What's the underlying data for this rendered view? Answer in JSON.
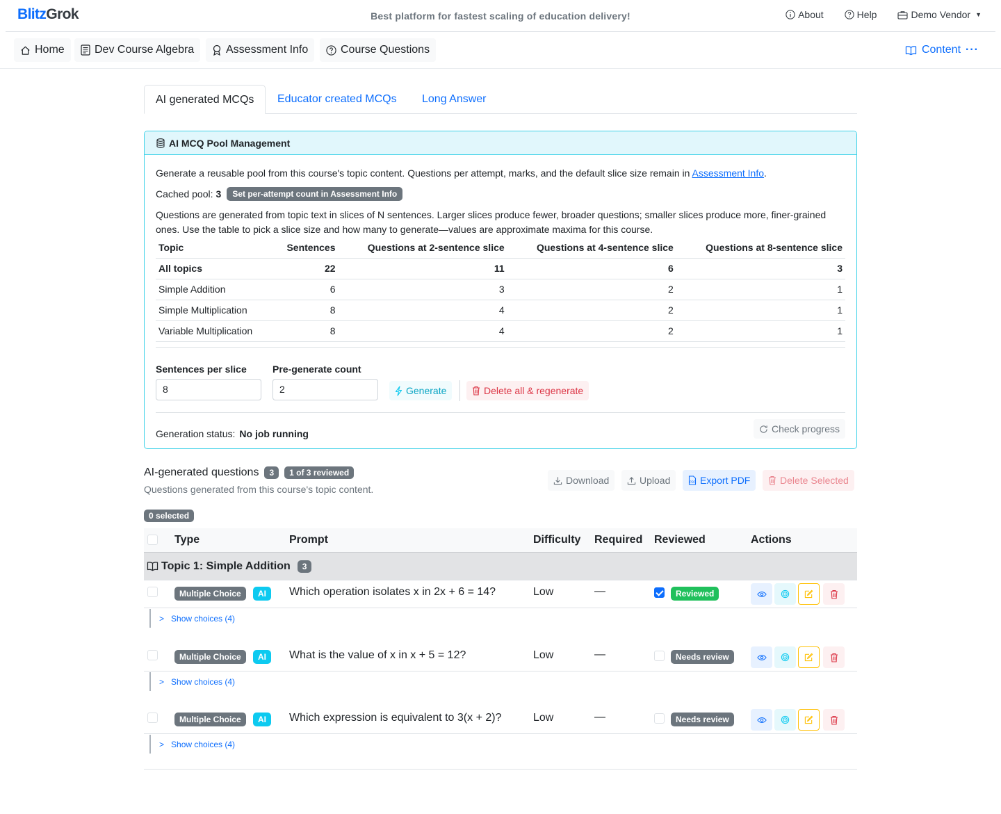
{
  "header": {
    "logo_part1": "Blitz",
    "logo_part2": "Grok",
    "tagline": "Best platform for fastest scaling of education delivery!",
    "about": "About",
    "help": "Help",
    "vendor": "Demo Vendor"
  },
  "nav": {
    "home": "Home",
    "course": "Dev Course Algebra",
    "assessment": "Assessment Info",
    "questions": "Course Questions",
    "content": "Content"
  },
  "tabs": {
    "ai": "AI generated MCQs",
    "educator": "Educator created MCQs",
    "long": "Long Answer"
  },
  "pool": {
    "title": "AI MCQ Pool Management",
    "intro_text": "Generate a reusable pool from this course's topic content. Questions per attempt, marks, and the default slice size remain in",
    "intro_link": "Assessment Info",
    "cached_label": "Cached pool:",
    "cached_value": "3",
    "cached_badge": "Set per-attempt count in Assessment Info",
    "explain": "Questions are generated from topic text in slices of N sentences. Larger slices produce fewer, broader questions; smaller slices produce more, finer-grained ones. Use the table to pick a slice size and how many to generate—values are approximate maxima for this course.",
    "table": {
      "headers": [
        "Topic",
        "Sentences",
        "Questions at 2-sentence slice",
        "Questions at 4-sentence slice",
        "Questions at 8-sentence slice"
      ],
      "total": [
        "All topics",
        "22",
        "11",
        "6",
        "3"
      ],
      "rows": [
        [
          "Simple Addition",
          "6",
          "3",
          "2",
          "1"
        ],
        [
          "Simple Multiplication",
          "8",
          "4",
          "2",
          "1"
        ],
        [
          "Variable Multiplication",
          "8",
          "4",
          "2",
          "1"
        ]
      ]
    },
    "slice_label": "Sentences per slice",
    "slice_value": "8",
    "count_label": "Pre-generate count",
    "count_value": "2",
    "generate": "Generate",
    "delete_regen": "Delete all & regenerate",
    "status_label": "Generation status:",
    "status_value": "No job running",
    "check": "Check progress"
  },
  "questions": {
    "title": "AI-generated questions",
    "count": "3",
    "reviewed_badge": "1 of 3 reviewed",
    "subtitle": "Questions generated from this course's topic content.",
    "download": "Download",
    "upload": "Upload",
    "export": "Export PDF",
    "delete_selected": "Delete Selected",
    "selected": "0 selected",
    "columns": {
      "type": "Type",
      "prompt": "Prompt",
      "difficulty": "Difficulty",
      "required": "Required",
      "reviewed": "Reviewed",
      "actions": "Actions"
    },
    "topic": "Topic 1: Simple Addition",
    "topic_count": "3",
    "rows": [
      {
        "type": "Multiple Choice",
        "ai": "AI",
        "prompt": "Which operation isolates x in 2x + 6 = 14?",
        "difficulty": "Low",
        "required": "—",
        "review": "Reviewed",
        "choices": "Show choices (4)"
      },
      {
        "type": "Multiple Choice",
        "ai": "AI",
        "prompt": "What is the value of x in x + 5 = 12?",
        "difficulty": "Low",
        "required": "—",
        "review": "Needs review",
        "choices": "Show choices (4)"
      },
      {
        "type": "Multiple Choice",
        "ai": "AI",
        "prompt": "Which expression is equivalent to 3(x + 2)?",
        "difficulty": "Low",
        "required": "—",
        "review": "Needs review",
        "choices": "Show choices (4)"
      }
    ]
  },
  "colors": {
    "primary": "#0d6efd",
    "info": "#0dcaf0",
    "success": "#20c05c",
    "danger": "#dc3545",
    "warning": "#ffc107",
    "secondary": "#6c757d"
  },
  "icons": [
    "info-icon",
    "help-icon",
    "briefcase-icon",
    "home-icon",
    "document-icon",
    "award-icon",
    "question-icon",
    "book-icon",
    "more-icon",
    "database-icon",
    "lightning-icon",
    "trash-icon",
    "refresh-icon",
    "download-icon",
    "upload-icon",
    "pdf-icon",
    "eye-icon",
    "target-icon",
    "edit-icon",
    "chevron-right-icon"
  ]
}
